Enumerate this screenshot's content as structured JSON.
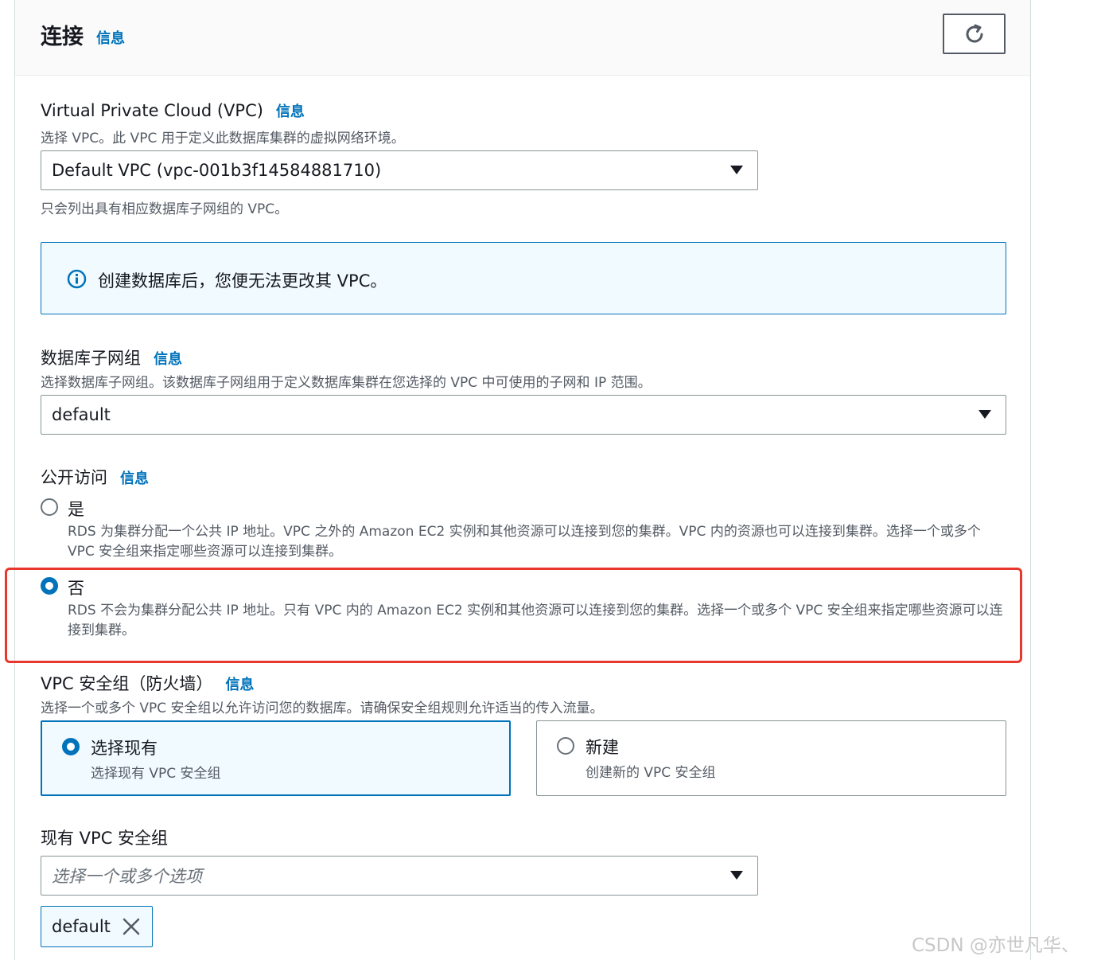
{
  "header": {
    "title": "连接",
    "info": "信息"
  },
  "vpc": {
    "label": "Virtual Private Cloud (VPC)",
    "info": "信息",
    "description": "选择 VPC。此 VPC 用于定义此数据库集群的虚拟网络环境。",
    "selected": "Default VPC (vpc-001b3f14584881710)",
    "hint": "只会列出具有相应数据库子网组的 VPC。",
    "alert": "创建数据库后，您便无法更改其 VPC。"
  },
  "subnet_group": {
    "label": "数据库子网组",
    "info": "信息",
    "description": "选择数据库子网组。该数据库子网组用于定义数据库集群在您选择的 VPC 中可使用的子网和 IP 范围。",
    "selected": "default"
  },
  "public_access": {
    "label": "公开访问",
    "info": "信息",
    "options": [
      {
        "label": "是",
        "description": "RDS 为集群分配一个公共 IP 地址。VPC 之外的 Amazon EC2 实例和其他资源可以连接到您的集群。VPC 内的资源也可以连接到集群。选择一个或多个 VPC 安全组来指定哪些资源可以连接到集群。",
        "checked": false
      },
      {
        "label": "否",
        "description": "RDS 不会为集群分配公共 IP 地址。只有 VPC 内的 Amazon EC2 实例和其他资源可以连接到您的集群。选择一个或多个 VPC 安全组来指定哪些资源可以连接到集群。",
        "checked": true
      }
    ]
  },
  "security_group": {
    "label": "VPC 安全组（防火墙）",
    "info": "信息",
    "description": "选择一个或多个 VPC 安全组以允许访问您的数据库。请确保安全组规则允许适当的传入流量。",
    "tiles": [
      {
        "title": "选择现有",
        "description": "选择现有 VPC 安全组",
        "selected": true
      },
      {
        "title": "新建",
        "description": "创建新的 VPC 安全组",
        "selected": false
      }
    ]
  },
  "existing_groups": {
    "label": "现有 VPC 安全组",
    "placeholder": "选择一个或多个选项",
    "tokens": [
      "default"
    ]
  },
  "watermark": "CSDN @亦世凡华、",
  "colors": {
    "link": "#0073bb",
    "highlight": "#e8382d",
    "info_bg": "#f1faff",
    "text": "#16191f",
    "secondary_text": "#545b64"
  }
}
